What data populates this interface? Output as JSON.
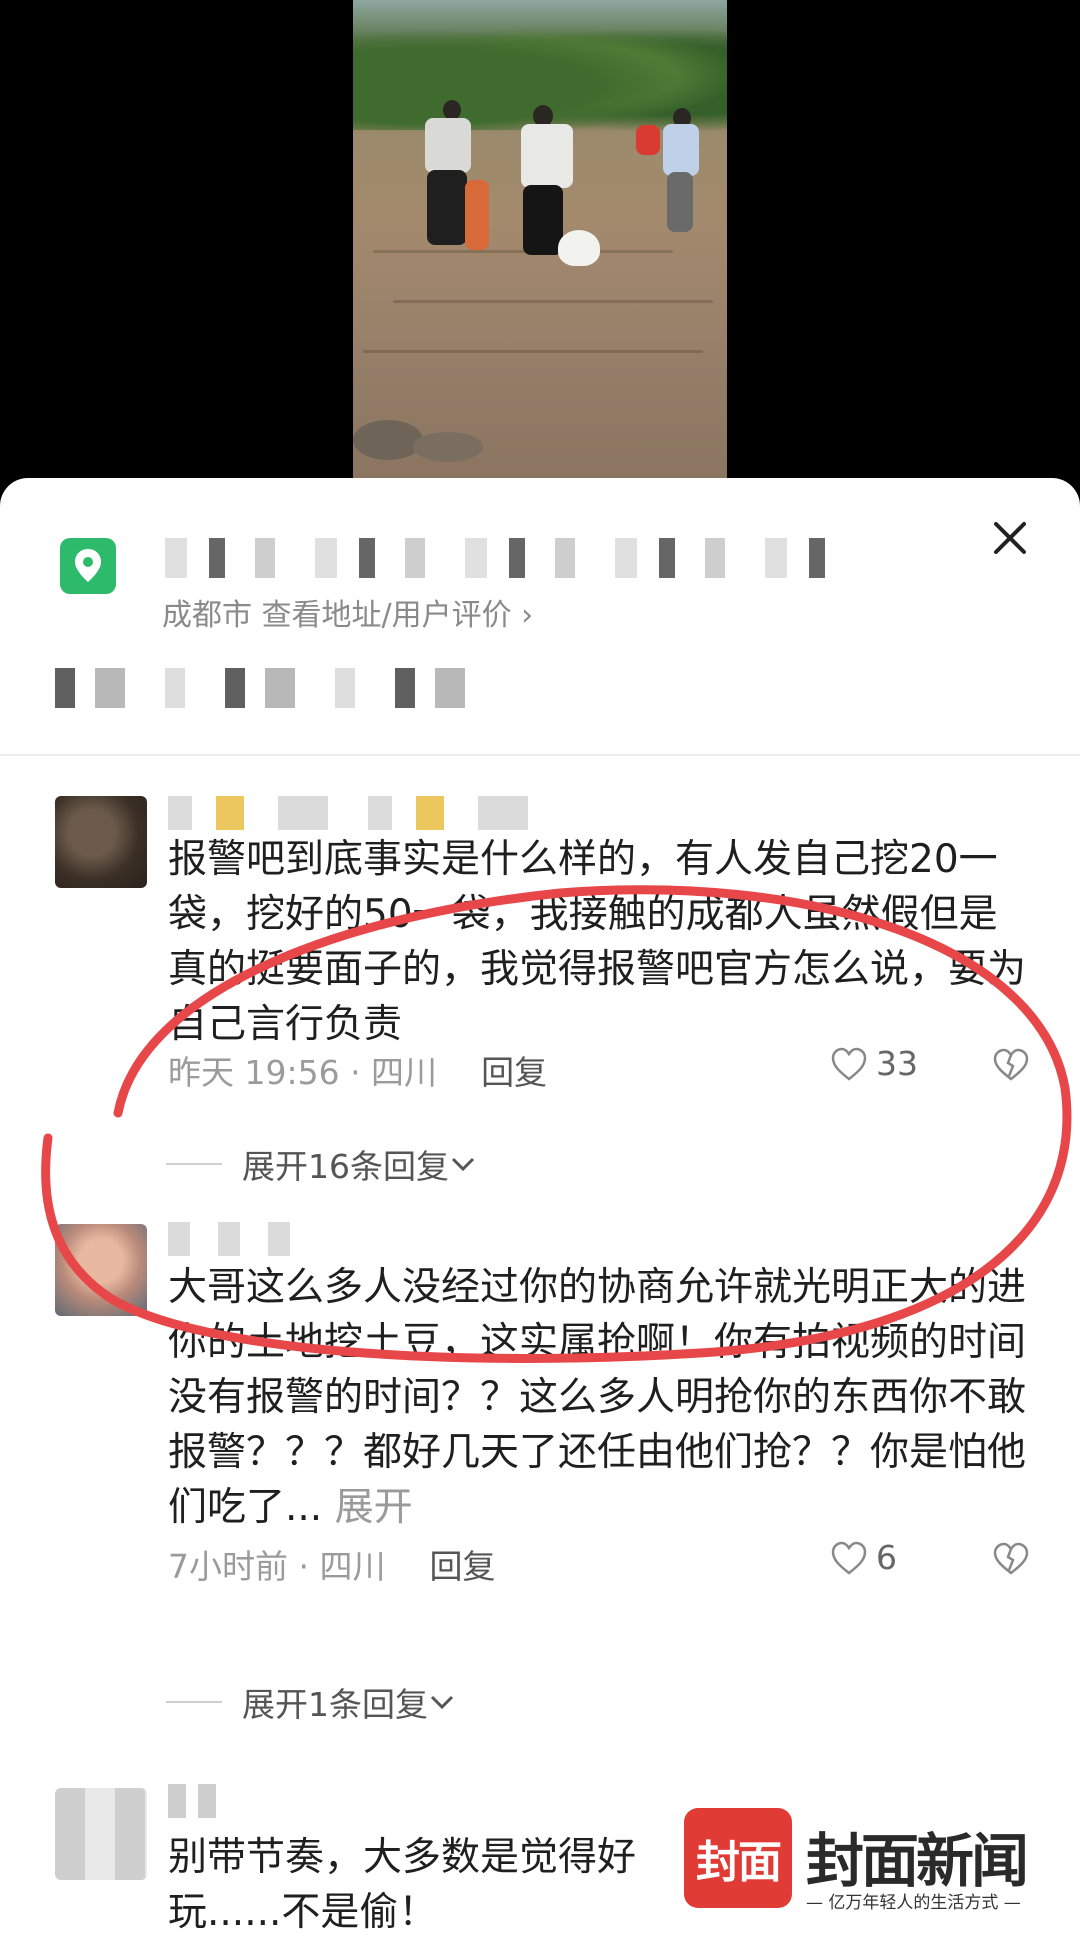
{
  "location": {
    "subtitle": "成都市 查看地址/用户评价 ›"
  },
  "comments": [
    {
      "text": "报警吧到底事实是什么样的，有人发自己挖20一袋，挖好的50一袋，我接触的成都人虽然假但是真的挺要面子的，我觉得报警吧官方怎么说，要为自己言行负责",
      "time_place": "昨天 19:56 · 四川",
      "reply_label": "回复",
      "likes": "33",
      "expand_label": "展开16条回复"
    },
    {
      "text": "大哥这么多人没经过你的协商允许就光明正大的进你的土地挖土豆，这实属抢啊！你有拍视频的时间没有报警的时间？？这么多人明抢你的东西你不敢报警？？？都好几天了还任由他们抢？？你是怕他们吃了...",
      "more_label": "展开",
      "time_place": "7小时前 · 四川",
      "reply_label": "回复",
      "likes": "6",
      "expand_label": "展开1条回复"
    },
    {
      "text": "别带节奏，大多数是觉得好玩......不是偷！"
    }
  ],
  "watermark": {
    "logo_text": "封面",
    "brand": "封面新闻",
    "slogan": "— 亿万年轻人的生活方式 —"
  },
  "colors": {
    "accent_green": "#2dbb6b",
    "annotation_red": "#e8474a",
    "brand_red": "#e03b35"
  }
}
